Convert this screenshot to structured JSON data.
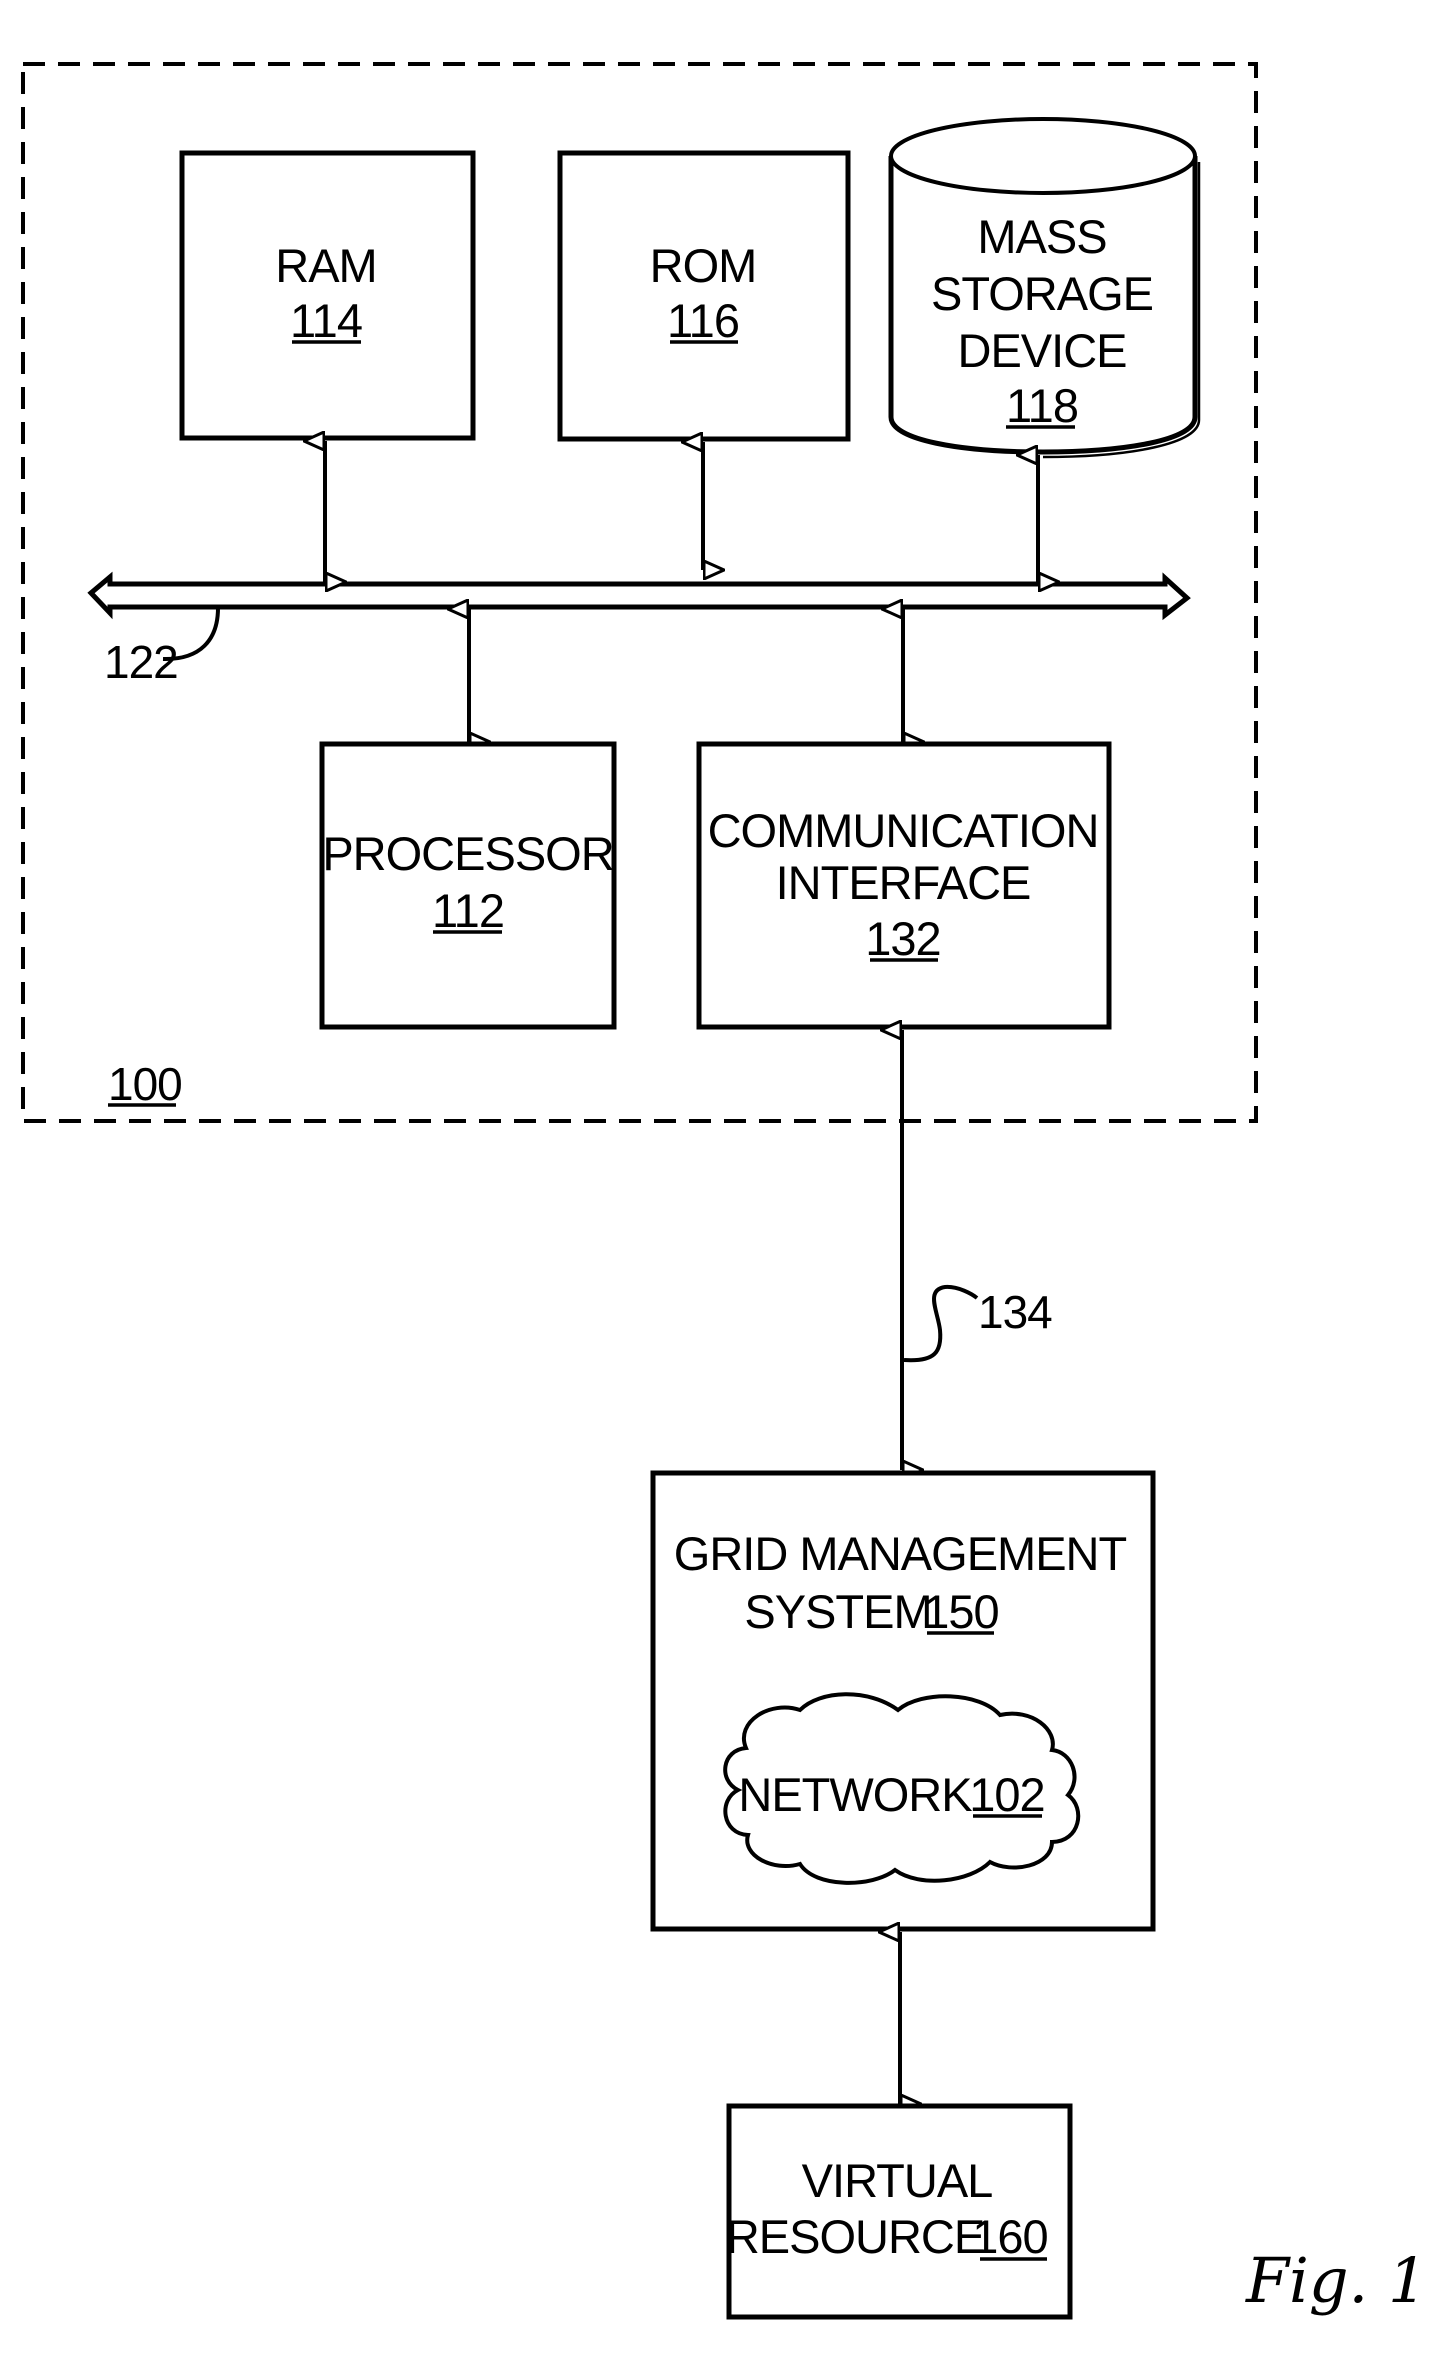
{
  "figure_label": "Fig. 1",
  "system": {
    "ref": "100"
  },
  "bus": {
    "ref": "122"
  },
  "link": {
    "ref": "134"
  },
  "components": {
    "ram": {
      "lines": [
        "RAM"
      ],
      "ref": "114"
    },
    "rom": {
      "lines": [
        "ROM"
      ],
      "ref": "116"
    },
    "mass_storage": {
      "lines": [
        "MASS",
        "STORAGE",
        "DEVICE"
      ],
      "ref": "118"
    },
    "processor": {
      "lines": [
        "PROCESSOR"
      ],
      "ref": "112"
    },
    "comm_interface": {
      "lines": [
        "COMMUNICATION",
        "INTERFACE"
      ],
      "ref": "132"
    },
    "grid_management": {
      "lines": [
        "GRID MANAGEMENT",
        "SYSTEM"
      ],
      "ref": "150"
    },
    "network": {
      "label": "NETWORK",
      "ref": "102"
    },
    "virtual_resource": {
      "lines": [
        "VIRTUAL",
        "RESOURCE"
      ],
      "ref": "160"
    }
  }
}
